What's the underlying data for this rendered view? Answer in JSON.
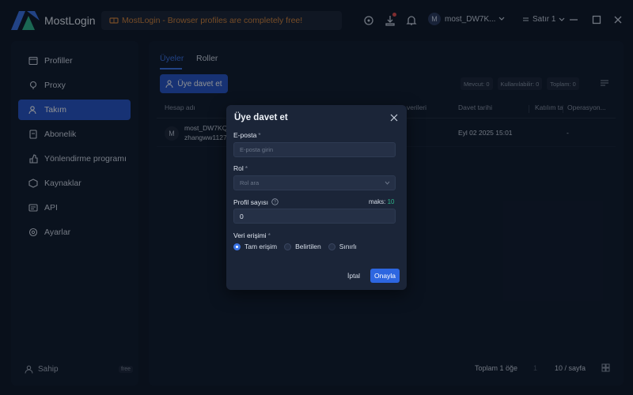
{
  "app": {
    "name": "MostLogin"
  },
  "titlebar": {
    "notice": "MostLogin - Browser profiles are completely free!",
    "user_avatar_letter": "M",
    "user_name": "most_DW7K...",
    "language": "Satır 1"
  },
  "sidebar": {
    "items": [
      {
        "label": "Profiller",
        "icon": "profile-icon"
      },
      {
        "label": "Proxy",
        "icon": "proxy-icon"
      },
      {
        "label": "Takım",
        "icon": "team-icon",
        "active": true
      },
      {
        "label": "Abonelik",
        "icon": "subscription-icon"
      },
      {
        "label": "Yönlendirme programı",
        "icon": "referral-icon"
      },
      {
        "label": "Kaynaklar",
        "icon": "resources-icon"
      },
      {
        "label": "API",
        "icon": "api-icon"
      },
      {
        "label": "Ayarlar",
        "icon": "settings-icon"
      }
    ],
    "owner_label": "Sahip",
    "plan_badge": "free"
  },
  "main": {
    "tabs": [
      {
        "label": "Üyeler"
      },
      {
        "label": "Roller"
      }
    ],
    "invite_button": "Üye davet et",
    "stats": {
      "current": "Mevcut: 0",
      "used": "Kullanılabilir: 0",
      "total": "Toplam: 0"
    },
    "table": {
      "headers": [
        "Hesap adı",
        "verileri",
        "Davet tarihi",
        "Katılım ta",
        "Operasyon..."
      ],
      "rows": [
        {
          "avatar": "M",
          "name": "most_DW7KQ",
          "email": "zhangww1127",
          "date": "Eyl 02 2025 15:01",
          "ops": "-"
        }
      ]
    },
    "footer": {
      "total": "Toplam 1 öğe",
      "page": "1",
      "page_size": "10 / sayfa"
    }
  },
  "modal": {
    "title": "Üye davet et",
    "email_label": "E-posta",
    "email_placeholder": "E-posta girin",
    "role_label": "Rol",
    "role_placeholder": "Rol ara",
    "profile_count_label": "Profil sayısı",
    "max_label": "maks:",
    "max_value": "10",
    "profile_count_value": "0",
    "data_access_label": "Veri erişimi",
    "access_options": [
      {
        "label": "Tam erişim",
        "checked": true
      },
      {
        "label": "Belirtilen",
        "checked": false
      },
      {
        "label": "Sınırlı",
        "checked": false
      }
    ],
    "cancel": "İptal",
    "confirm": "Onayla"
  },
  "colors": {
    "accent": "#2755c6",
    "background": "#0d1626",
    "panel": "#101a2b",
    "warning": "#d4833a"
  }
}
